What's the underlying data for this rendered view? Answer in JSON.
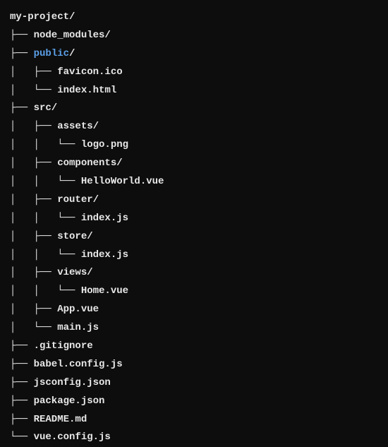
{
  "tree": {
    "line0": "my-project/",
    "line1": "├── node_modules/",
    "line2_prefix": "├── ",
    "line2_link": "public",
    "line2_suffix": "/",
    "line3": "│   ├── favicon.ico",
    "line4": "│   └── index.html",
    "line5": "├── src/",
    "line6": "│   ├── assets/",
    "line7": "│   │   └── logo.png",
    "line8": "│   ├── components/",
    "line9": "│   │   └── HelloWorld.vue",
    "line10": "│   ├── router/",
    "line11": "│   │   └── index.js",
    "line12": "│   ├── store/",
    "line13": "│   │   └── index.js",
    "line14": "│   ├── views/",
    "line15": "│   │   └── Home.vue",
    "line16": "│   ├── App.vue",
    "line17": "│   └── main.js",
    "line18": "├── .gitignore",
    "line19": "├── babel.config.js",
    "line20": "├── jsconfig.json",
    "line21": "├── package.json",
    "line22": "├── README.md",
    "line23": "└── vue.config.js"
  }
}
